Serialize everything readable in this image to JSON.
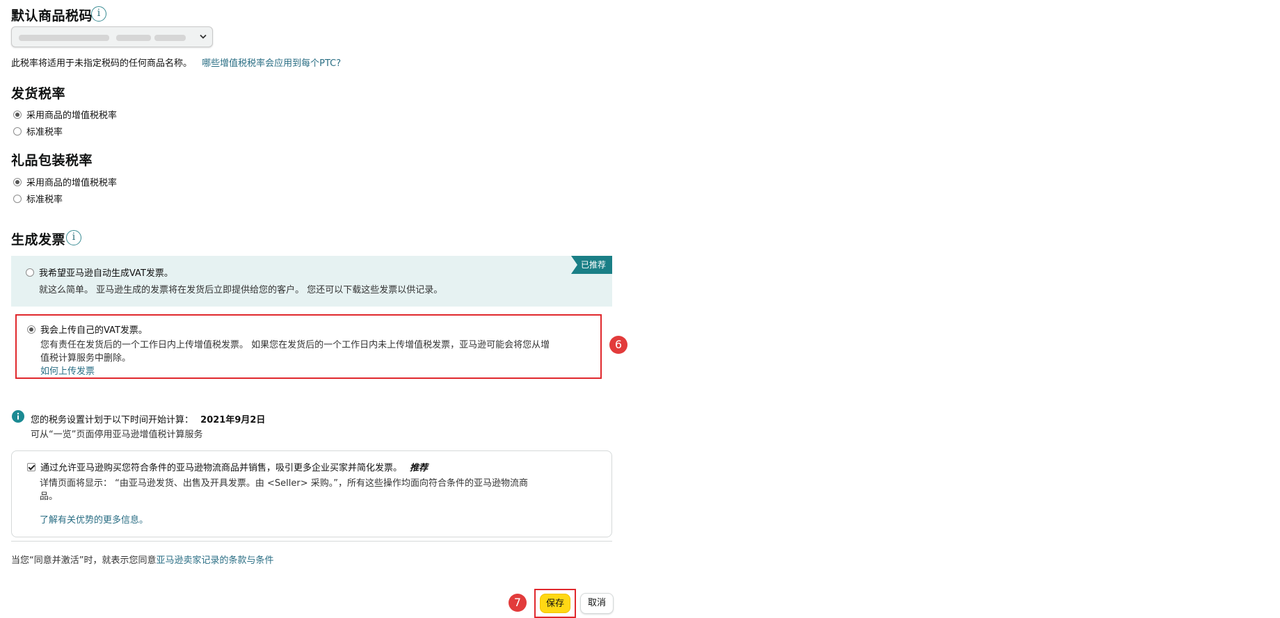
{
  "default_tax_code": {
    "title": "默认商品税码",
    "selected_value": "",
    "help_text": "此税率将适用于未指定税码的任何商品名称。",
    "help_link": "哪些增值税税率会应用到每个PTC?"
  },
  "shipping_tax": {
    "title": "发货税率",
    "options": [
      {
        "label": "采用商品的增值税税率",
        "checked": true
      },
      {
        "label": "标准税率",
        "checked": false
      }
    ]
  },
  "gift_wrap_tax": {
    "title": "礼品包装税率",
    "options": [
      {
        "label": "采用商品的增值税税率",
        "checked": true
      },
      {
        "label": "标准税率",
        "checked": false
      }
    ]
  },
  "invoice": {
    "title": "生成发票",
    "auto": {
      "label": "我希望亚马逊自动生成VAT发票。",
      "desc": "就这么简单。 亚马逊生成的发票将在发货后立即提供给您的客户。 您还可以下载这些发票以供记录。",
      "badge": "已推荐",
      "checked": false
    },
    "upload": {
      "label": "我会上传自己的VAT发票。",
      "desc_line1": "您有责任在发货后的一个工作日内上传增值税发票。 如果您在发货后的一个工作日内未上传增值税发票，亚马逊可能会将您从增",
      "desc_line2": "值税计算服务中删除。",
      "link": "如何上传发票",
      "checked": true
    }
  },
  "schedule_notice": {
    "text": "您的税务设置计划于以下时间开始计算：",
    "date": "2021年9月2日",
    "sub": "可从“一览”页面停用亚马逊增值税计算服务"
  },
  "business": {
    "label": "通过允许亚马逊购买您符合条件的亚马逊物流商品并销售，吸引更多企业买家并简化发票。",
    "tag": "推荐",
    "detail_line1": "详情页面将显示：  “由亚马逊发货、出售及开具发票。由 <Seller> 采购。”，所有这些操作均面向符合条件的亚马逊物流商",
    "detail_line2": "品。",
    "link": "了解有关优势的更多信息。",
    "checked": true
  },
  "terms": {
    "prefix": "当您“同意并激活”时，就表示您同意",
    "link": "亚马逊卖家记录的条款与条件"
  },
  "annotations": {
    "marker_6": "6",
    "marker_7": "7"
  },
  "actions": {
    "save": "保存",
    "cancel": "取消"
  },
  "colors": {
    "link": "#2a6e84",
    "highlight_border": "#e0282d",
    "recommended_bg": "#e6f2f2",
    "badge_bg": "#1a7f86",
    "primary_button": "#ffd814"
  }
}
